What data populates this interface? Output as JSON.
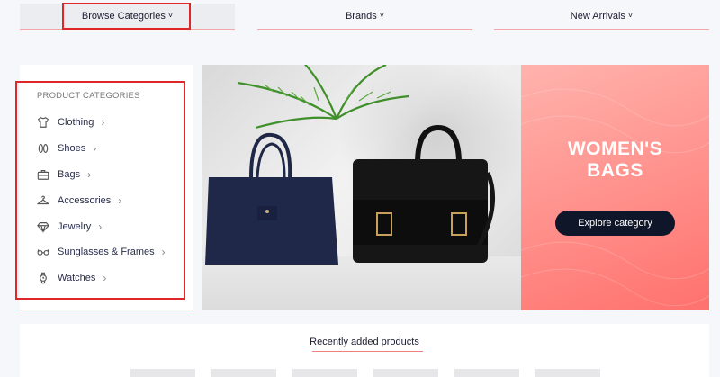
{
  "nav": {
    "browse_label": "Browse Categories",
    "brands_label": "Brands",
    "new_arrivals_label": "New Arrivals"
  },
  "categories": {
    "title": "PRODUCT CATEGORIES",
    "items": [
      {
        "label": "Clothing",
        "icon": "shirt-icon"
      },
      {
        "label": "Shoes",
        "icon": "shoes-icon"
      },
      {
        "label": "Bags",
        "icon": "bag-icon"
      },
      {
        "label": "Accessories",
        "icon": "hanger-icon"
      },
      {
        "label": "Jewelry",
        "icon": "diamond-icon"
      },
      {
        "label": "Sunglasses & Frames",
        "icon": "glasses-icon"
      },
      {
        "label": "Watches",
        "icon": "watch-icon"
      }
    ]
  },
  "promo": {
    "title_line1": "WOMEN'S",
    "title_line2": "BAGS",
    "button_label": "Explore category"
  },
  "recent": {
    "title": "Recently added products"
  },
  "colors": {
    "highlight": "#e02727",
    "promo_bg": "#ff8f8a",
    "button_bg": "#0f1629",
    "accent_line": "#f08080"
  }
}
